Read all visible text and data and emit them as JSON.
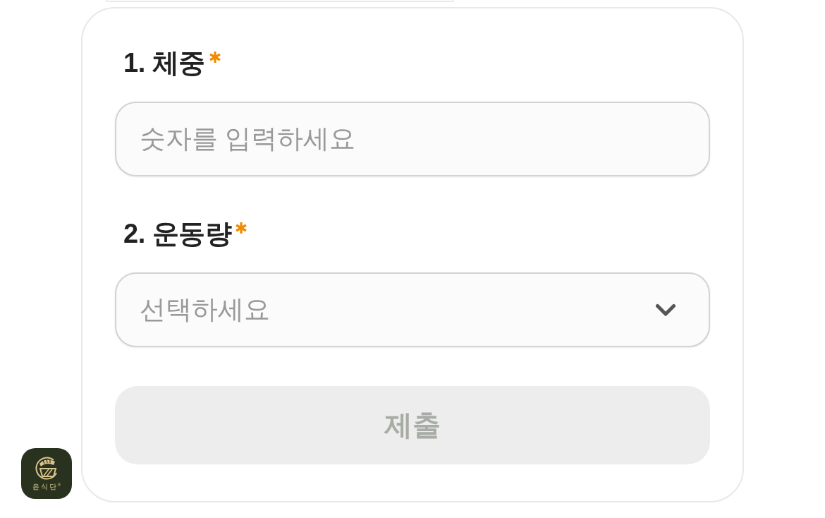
{
  "form": {
    "fields": [
      {
        "kind": "text",
        "label": "1. 체중",
        "required": true,
        "placeholder": "숫자를 입력하세요"
      },
      {
        "kind": "select",
        "label": "2. 운동량",
        "required": true,
        "placeholder": "선택하세요"
      }
    ],
    "submit": {
      "label": "제출",
      "disabled": true
    }
  },
  "logo": {
    "text": "윤식단$^{®}$"
  }
}
